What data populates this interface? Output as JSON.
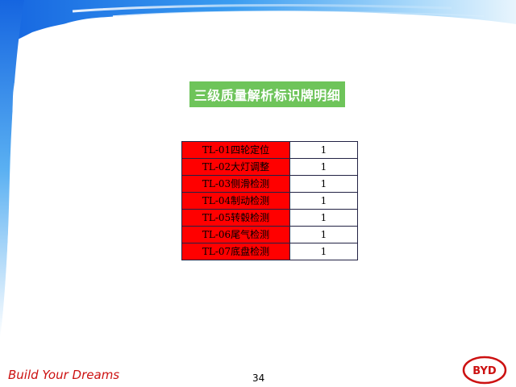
{
  "slide": {
    "title": "三级质量解析标识牌明细",
    "footer_slogan": "Build Your Dreams",
    "page_number": "34",
    "logo_text": "BYD",
    "colors": {
      "title_bg": "#6ec45a",
      "item_bg": "#ff0000",
      "slogan": "#cc1111",
      "logo": "#cc1111",
      "deco_blue": "#1e90ff"
    }
  },
  "table": {
    "rows": [
      {
        "name": "TL-01四轮定位",
        "count": "1"
      },
      {
        "name": "TL-02大灯调整",
        "count": "1"
      },
      {
        "name": "TL-03侧滑检测",
        "count": "1"
      },
      {
        "name": "TL-04制动检测",
        "count": "1"
      },
      {
        "name": "TL-05转毂检测",
        "count": "1"
      },
      {
        "name": "TL-06尾气检测",
        "count": "1"
      },
      {
        "name": "TL-07底盘检测",
        "count": "1"
      }
    ]
  }
}
